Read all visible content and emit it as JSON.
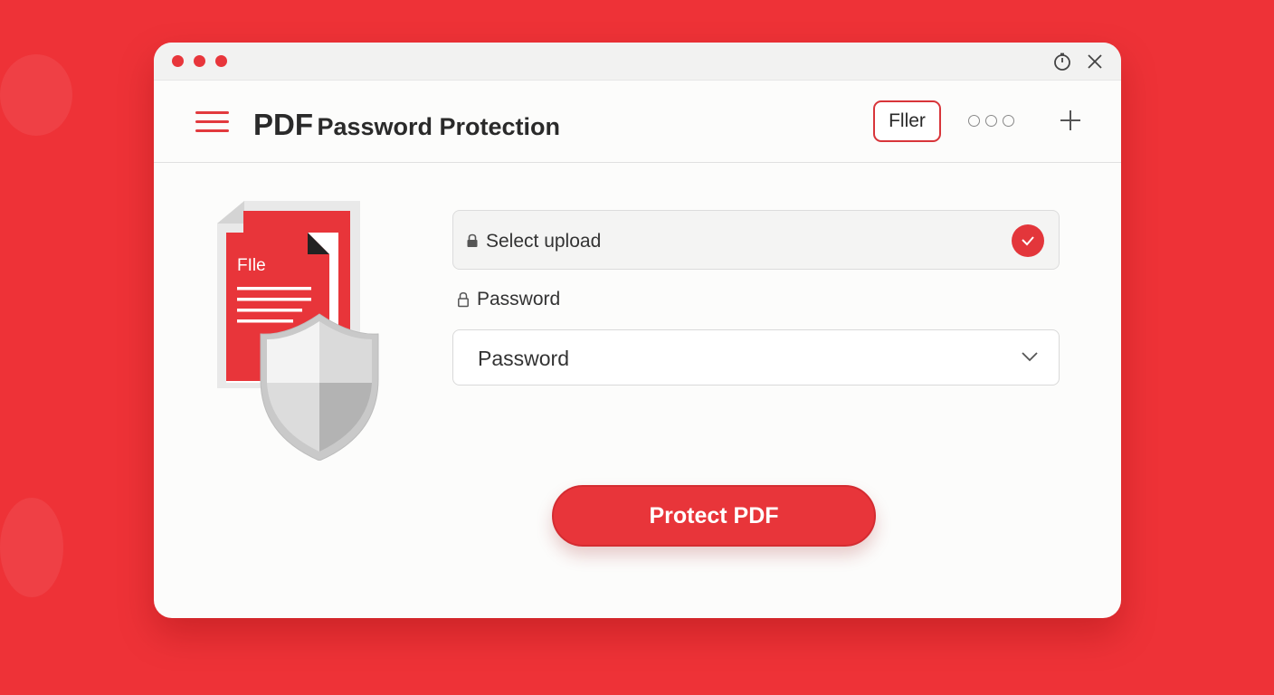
{
  "window": {
    "title_bold": "PDF",
    "title_rest": "Password Protection",
    "filer_label": "Fller"
  },
  "illustration": {
    "doc_label": "FIle"
  },
  "form": {
    "upload_label": "Select upload",
    "password_label": "Password",
    "password_value": "Password"
  },
  "action": {
    "protect_label": "Protect PDF"
  },
  "icons": {
    "menu": "hamburger-icon",
    "timer": "timer-icon",
    "close": "close-icon",
    "more": "more-icon",
    "add": "plus-icon",
    "upload_lock": "lock-icon",
    "check": "check-icon",
    "password_lock": "lock-outline-icon",
    "dropdown": "chevron-down-icon"
  },
  "colors": {
    "brand": "#ee3237",
    "accent": "#e8353a",
    "window_bg": "#fcfcfb"
  }
}
